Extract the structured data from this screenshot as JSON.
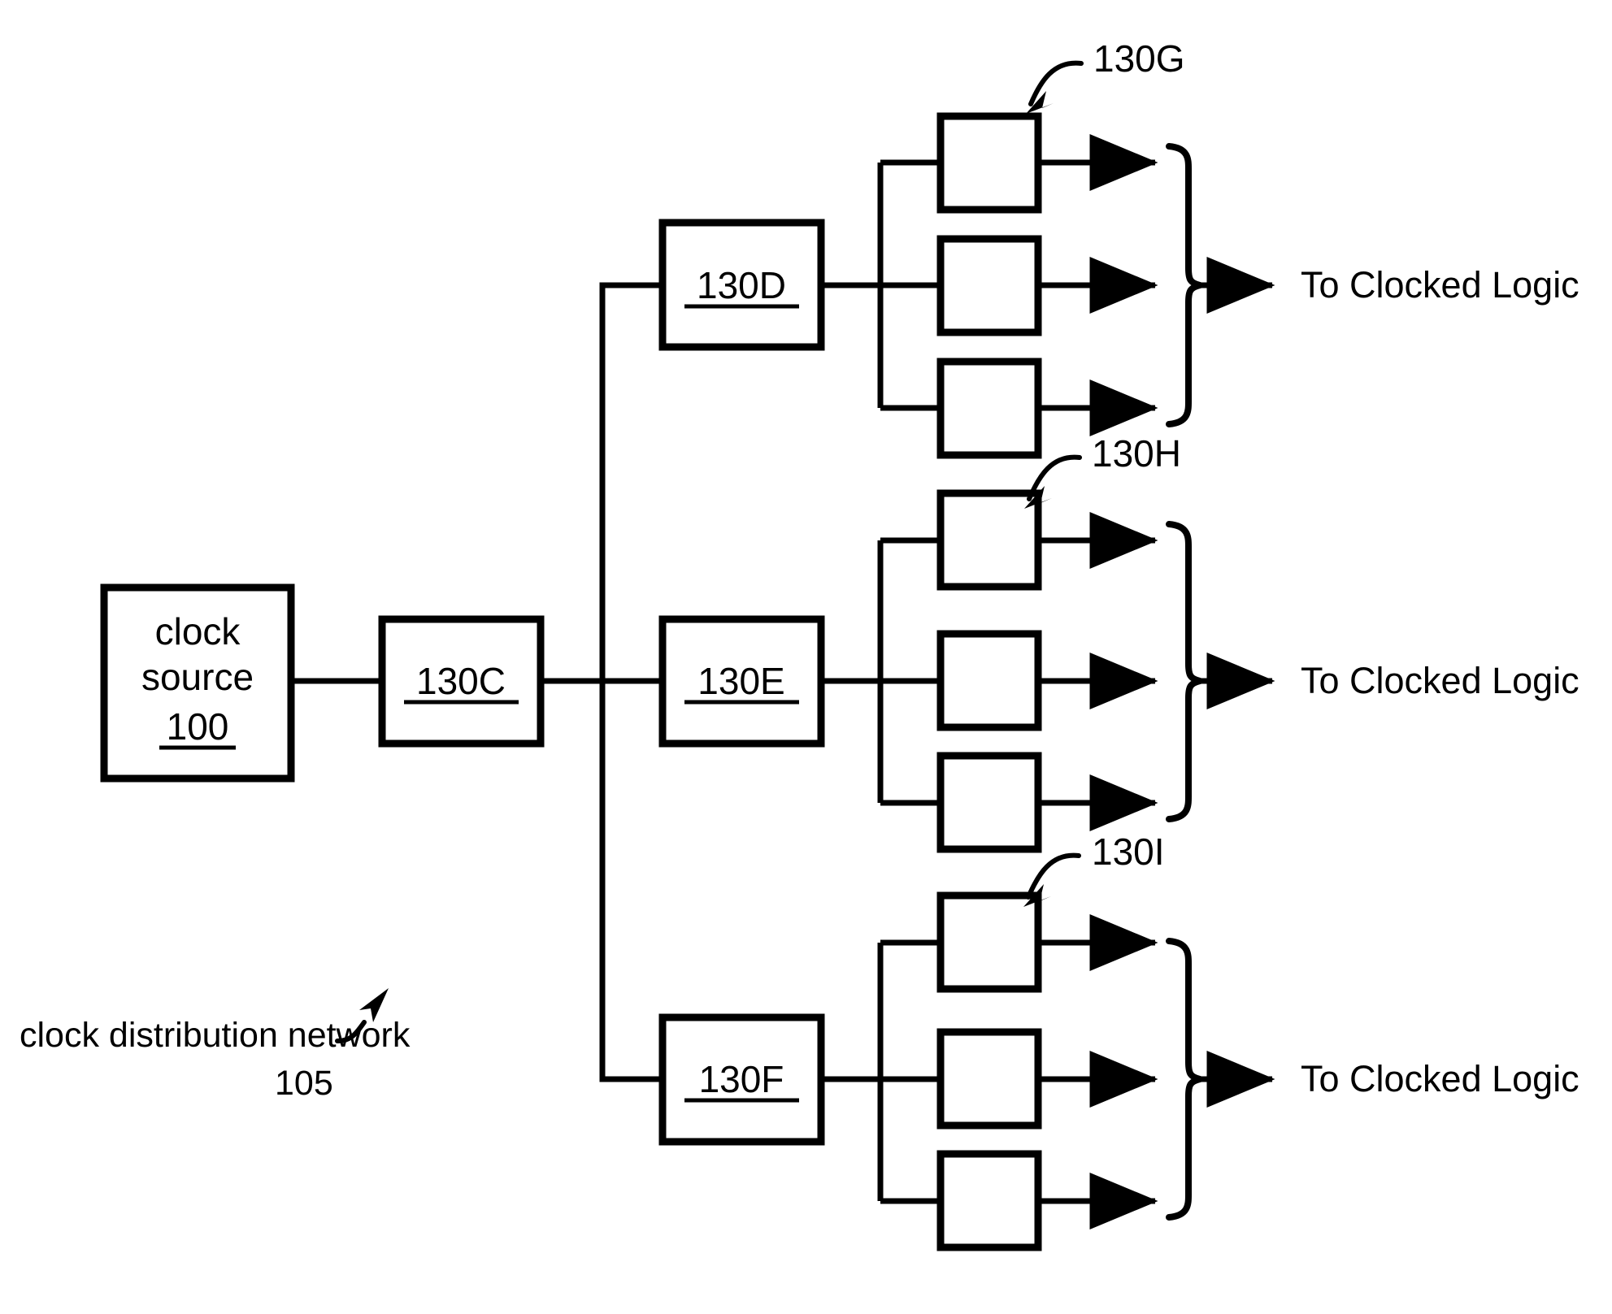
{
  "figure": {
    "title": "clock distribution network diagram",
    "background_color": "#ffffff",
    "line_color": "#000000"
  },
  "source": {
    "line1": "clock",
    "line2": "source",
    "ref": "100"
  },
  "buffers": {
    "root": {
      "label": "130C"
    },
    "level2": [
      {
        "label": "130D"
      },
      {
        "label": "130E"
      },
      {
        "label": "130F"
      }
    ]
  },
  "leaf_groups": [
    {
      "ref_label": "130G",
      "destination": "To Clocked Logic"
    },
    {
      "ref_label": "130H",
      "destination": "To Clocked Logic"
    },
    {
      "ref_label": "130I",
      "destination": "To Clocked Logic"
    }
  ],
  "caption": {
    "text": "clock distribution network",
    "ref": "105"
  }
}
